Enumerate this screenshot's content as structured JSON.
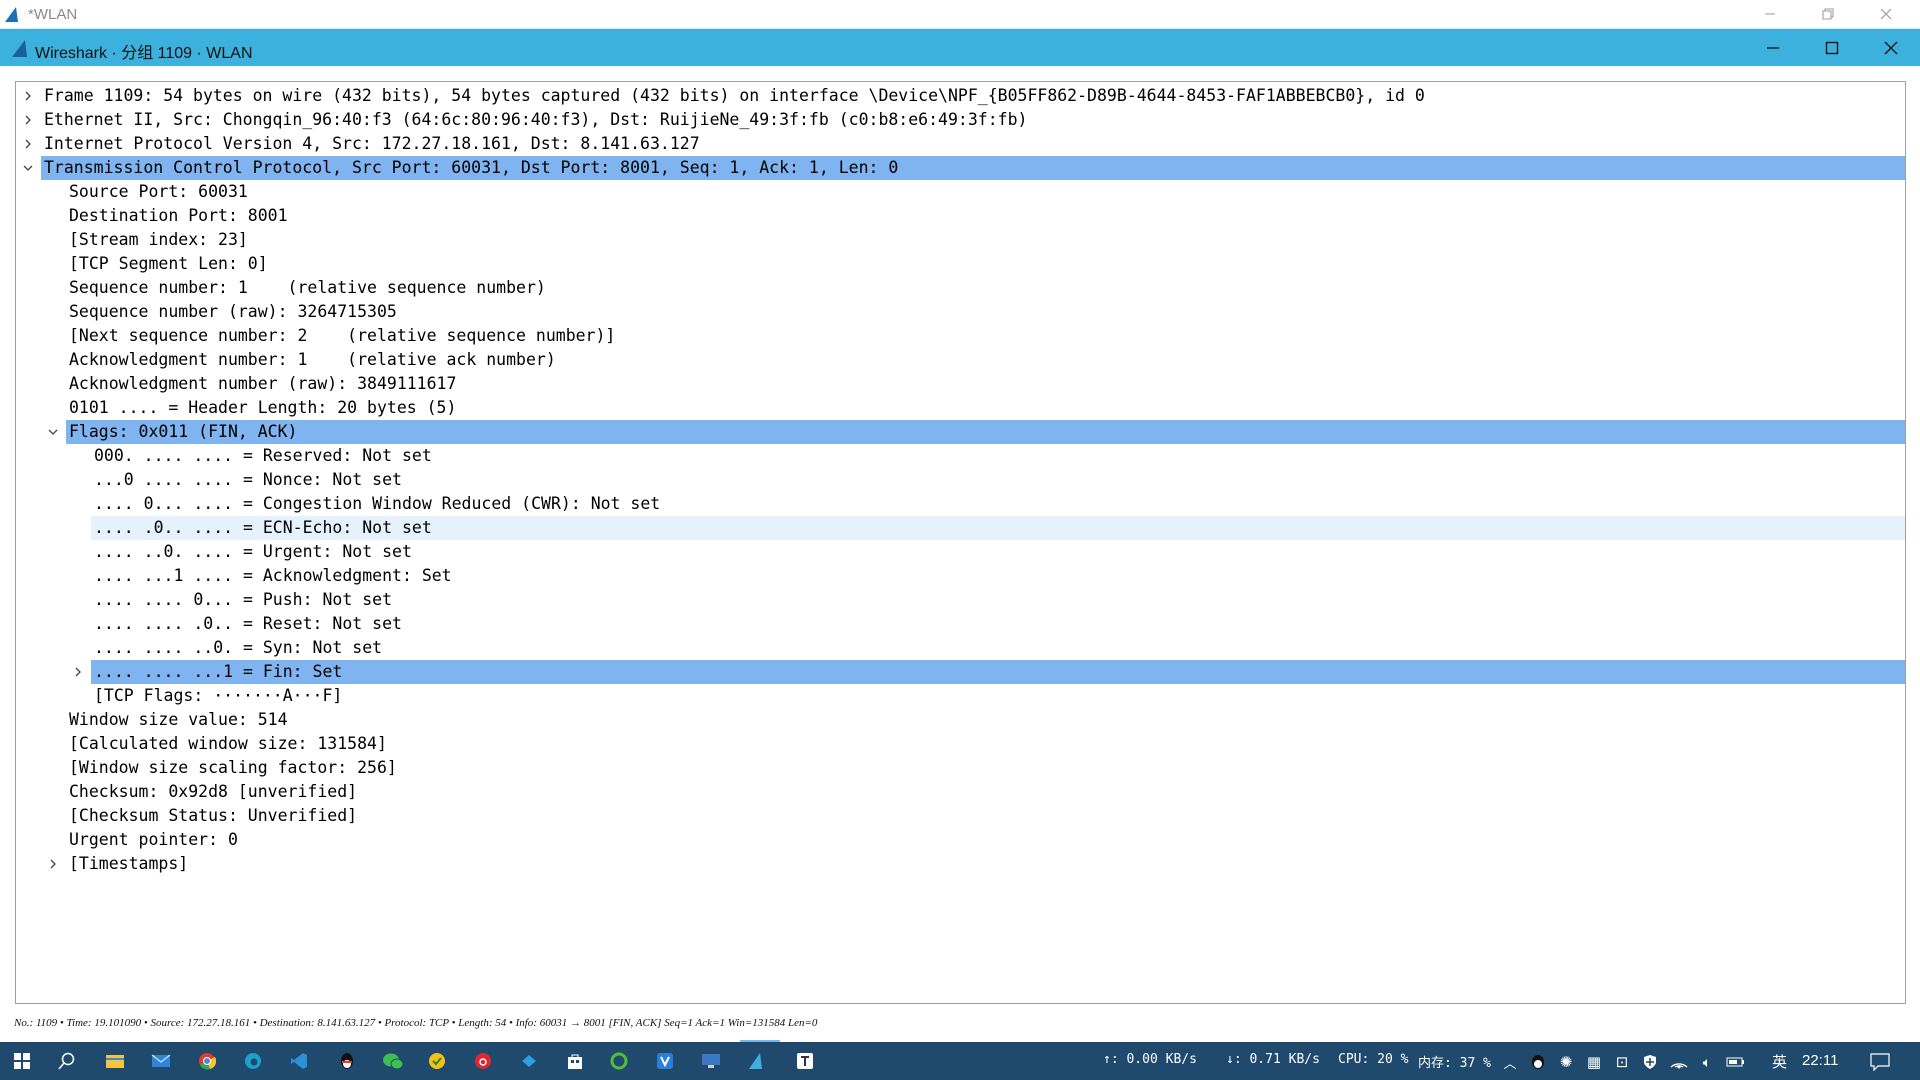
{
  "outer_window": {
    "title": "*WLAN"
  },
  "inner_window": {
    "title": "Wireshark · 分组 1109 · WLAN"
  },
  "detail_rows": [
    {
      "text": "Frame 1109: 54 bytes on wire (432 bits), 54 bytes captured (432 bits) on interface \\Device\\NPF_{B05FF862-D89B-4644-8453-FAF1ABBEBCB0}, id 0",
      "level": 0,
      "expander": "collapsed"
    },
    {
      "text": "Ethernet II, Src: Chongqin_96:40:f3 (64:6c:80:96:40:f3), Dst: RuijieNe_49:3f:fb (c0:b8:e6:49:3f:fb)",
      "level": 0,
      "expander": "collapsed"
    },
    {
      "text": "Internet Protocol Version 4, Src: 172.27.18.161, Dst: 8.141.63.127",
      "level": 0,
      "expander": "collapsed"
    },
    {
      "text": "Transmission Control Protocol, Src Port: 60031, Dst Port: 8001, Seq: 1, Ack: 1, Len: 0",
      "level": 0,
      "expander": "expanded",
      "highlight": "selected"
    },
    {
      "text": "Source Port: 60031",
      "level": 1
    },
    {
      "text": "Destination Port: 8001",
      "level": 1
    },
    {
      "text": "[Stream index: 23]",
      "level": 1
    },
    {
      "text": "[TCP Segment Len: 0]",
      "level": 1
    },
    {
      "text": "Sequence number: 1    (relative sequence number)",
      "level": 1
    },
    {
      "text": "Sequence number (raw): 3264715305",
      "level": 1
    },
    {
      "text": "[Next sequence number: 2    (relative sequence number)]",
      "level": 1
    },
    {
      "text": "Acknowledgment number: 1    (relative ack number)",
      "level": 1
    },
    {
      "text": "Acknowledgment number (raw): 3849111617",
      "level": 1
    },
    {
      "text": "0101 .... = Header Length: 20 bytes (5)",
      "level": 1
    },
    {
      "text": "Flags: 0x011 (FIN, ACK)",
      "level": 1,
      "expander": "expanded",
      "highlight": "selected"
    },
    {
      "text": "000. .... .... = Reserved: Not set",
      "level": 2
    },
    {
      "text": "...0 .... .... = Nonce: Not set",
      "level": 2
    },
    {
      "text": ".... 0... .... = Congestion Window Reduced (CWR): Not set",
      "level": 2
    },
    {
      "text": ".... .0.. .... = ECN-Echo: Not set",
      "level": 2,
      "highlight": "hover"
    },
    {
      "text": ".... ..0. .... = Urgent: Not set",
      "level": 2
    },
    {
      "text": ".... ...1 .... = Acknowledgment: Set",
      "level": 2
    },
    {
      "text": ".... .... 0... = Push: Not set",
      "level": 2
    },
    {
      "text": ".... .... .0.. = Reset: Not set",
      "level": 2
    },
    {
      "text": ".... .... ..0. = Syn: Not set",
      "level": 2
    },
    {
      "text": ".... .... ...1 = Fin: Set",
      "level": 2,
      "expander": "collapsed",
      "highlight": "selected"
    },
    {
      "text": "[TCP Flags: ·······A···F]",
      "level": 2
    },
    {
      "text": "Window size value: 514",
      "level": 1
    },
    {
      "text": "[Calculated window size: 131584]",
      "level": 1
    },
    {
      "text": "[Window size scaling factor: 256]",
      "level": 1
    },
    {
      "text": "Checksum: 0x92d8 [unverified]",
      "level": 1
    },
    {
      "text": "[Checksum Status: Unverified]",
      "level": 1
    },
    {
      "text": "Urgent pointer: 0",
      "level": 1
    },
    {
      "text": "[Timestamps]",
      "level": 1,
      "expander": "collapsed"
    }
  ],
  "status_line": "No.: 1109 • Time: 19.101090 • Source: 172.27.18.161 • Destination: 8.141.63.127 • Protocol: TCP • Length: 54 • Info: 60031 → 8001 [FIN, ACK] Seq=1 Ack=1 Win=131584 Len=0",
  "taskbar": {
    "apps": [
      "start-icon",
      "search-icon",
      "file-explorer-icon",
      "mail-icon",
      "chrome-icon",
      "edge-icon",
      "vscode-icon",
      "qq-icon",
      "wechat-icon",
      "app-yellow-icon",
      "netease-music-icon",
      "feishu-icon",
      "store-icon",
      "app-green-icon",
      "app-v-icon",
      "app-desktop-icon",
      "wireshark-icon",
      "typora-icon"
    ],
    "upload": "↑: 0.00 KB/s",
    "download": "↓: 0.71 KB/s",
    "cpu": "CPU: 20 %",
    "memory": "内存: 37 %",
    "ime": "英",
    "clock": "22:11"
  },
  "colors": {
    "titlebar": "#3db1de",
    "selected_row": "#80b4f0",
    "hover_row": "#e5f1fb",
    "taskbar": "#1f4a6d"
  }
}
